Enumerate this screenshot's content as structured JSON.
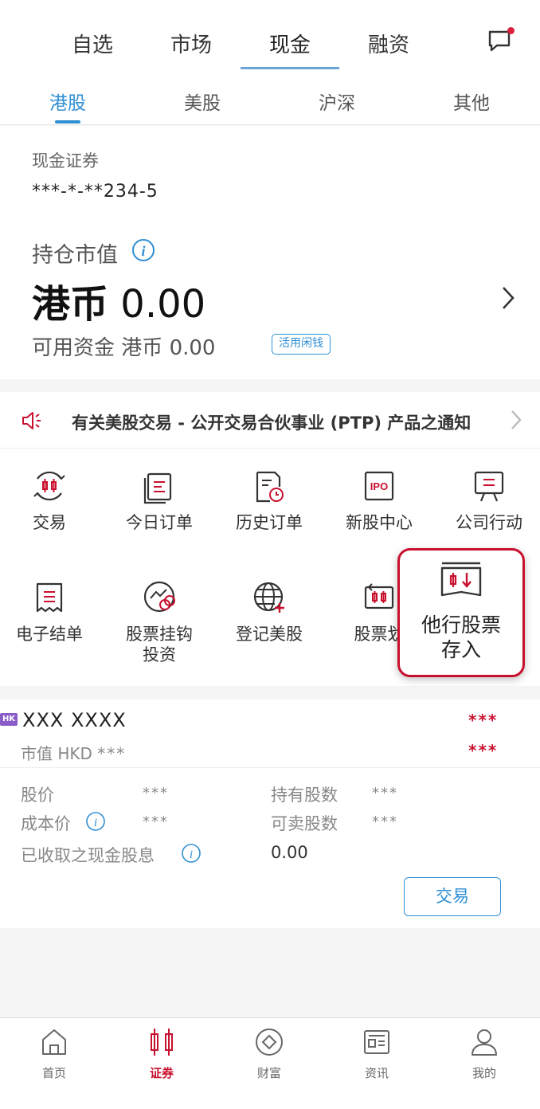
{
  "top_tabs": [
    "自选",
    "市场",
    "现金",
    "融资"
  ],
  "sub_tabs": [
    "港股",
    "美股",
    "沪深",
    "其他"
  ],
  "account": {
    "type": "现金证券",
    "number": "***-*-**234-5",
    "market_value_label": "持仓市值",
    "currency": "港币",
    "market_value": "0.00",
    "available_label": "可用资金",
    "available_currency": "港币",
    "available_value": "0.00",
    "idle_badge": "活用闲钱"
  },
  "notice": "有关美股交易 - 公开交易合伙事业 (PTP) 产品之通知",
  "grid": {
    "row1": [
      "交易",
      "今日订单",
      "历史订单",
      "新股中心",
      "公司行动"
    ],
    "row2": [
      "电子结单",
      "股票挂钩投资",
      "登记美股",
      "股票划"
    ],
    "highlight": "他行股票存入"
  },
  "holding": {
    "market_badge": "HK",
    "name": "XXX  XXXX",
    "mv_label": "市值 HKD",
    "mask": "***",
    "price_label": "股价",
    "qty_label": "持有股数",
    "cost_label": "成本价",
    "sellable_label": "可卖股数",
    "dividend_label": "已收取之现金股息",
    "dividend_value": "0.00",
    "trade_button": "交易"
  },
  "bottom_nav": [
    "首页",
    "证券",
    "财富",
    "资讯",
    "我的"
  ],
  "colors": {
    "accent_blue": "#2f8fd3",
    "brand_red": "#c8102e",
    "hk_purple": "#8a5cc9"
  }
}
